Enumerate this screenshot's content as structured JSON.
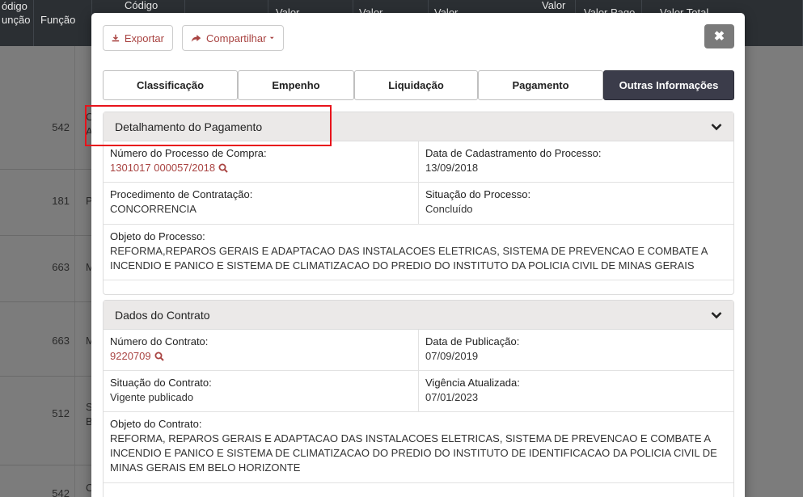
{
  "background_table": {
    "headers": [
      {
        "line1": "ódigo",
        "line2": "unção"
      },
      {
        "line1": "Função",
        "line2": ""
      },
      {
        "line1": "Código",
        "line2": ""
      },
      {
        "line1": "Valor",
        "line2": ""
      },
      {
        "line1": "Valor",
        "line2": ""
      },
      {
        "line1": "Valor Pago",
        "line2": ""
      },
      {
        "line1": "Valor",
        "line2": ""
      },
      {
        "line1": "Valor Pago",
        "line2": ""
      },
      {
        "line1": "Valor Total",
        "line2": ""
      }
    ],
    "rows": [
      {
        "num": "542",
        "letter": "C",
        "letter2": "A"
      },
      {
        "num": "181",
        "letter": "P",
        "letter2": ""
      },
      {
        "num": "663",
        "letter": "M",
        "letter2": ""
      },
      {
        "num": "663",
        "letter": "M",
        "letter2": ""
      },
      {
        "num": "512",
        "letter": "S",
        "letter2": "B"
      },
      {
        "num": "542",
        "letter": "C",
        "letter2": ""
      }
    ]
  },
  "toolbar": {
    "export_label": "Exportar",
    "share_label": "Compartilhar",
    "close_label": "✖"
  },
  "tabs": [
    {
      "label": "Classificação",
      "active": false
    },
    {
      "label": "Empenho",
      "active": false
    },
    {
      "label": "Liquidação",
      "active": false
    },
    {
      "label": "Pagamento",
      "active": false
    },
    {
      "label": "Outras Informações",
      "active": true
    }
  ],
  "payment_detail": {
    "title": "Detalhamento do Pagamento",
    "process_number_label": "Número do Processo de Compra:",
    "process_number_value": "1301017 000057/2018",
    "registration_date_label": "Data de Cadastramento do Processo:",
    "registration_date_value": "13/09/2018",
    "procedure_label": "Procedimento de Contratação:",
    "procedure_value": "CONCORRENCIA",
    "process_status_label": "Situação do Processo:",
    "process_status_value": "Concluído",
    "object_label": "Objeto do Processo:",
    "object_line1": "REFORMA,REPAROS GERAIS E ADAPTACAO DAS INSTALACOES ELETRICAS, SISTEMA DE PREVENCAO E COMBATE A",
    "object_line2": "INCENDIO E PANICO E SISTEMA DE CLIMATIZACAO DO PREDIO DO INSTITUTO DA POLICIA CIVIL DE MINAS GERAIS"
  },
  "contract": {
    "title": "Dados do Contrato",
    "number_label": "Número do Contrato:",
    "number_value": "9220709",
    "publication_label": "Data de Publicação:",
    "publication_value": "07/09/2019",
    "status_label": "Situação do Contrato:",
    "status_value": "Vigente publicado",
    "validity_label": "Vigência Atualizada:",
    "validity_value": "07/01/2023",
    "object_label": "Objeto do Contrato:",
    "object_line1": "REFORMA, REPAROS GERAIS E ADAPTACAO DAS INSTALACOES ELETRICAS, SISTEMA DE PREVENCAO E COMBATE A",
    "object_line2": "INCENDIO E PANICO E SISTEMA DE CLIMATIZACAO DO PREDIO DO INSTITUTO DE IDENTIFICACAO DA POLICIA CIVIL DE",
    "object_line3": "MINAS GERAIS EM BELO HORIZONTE"
  },
  "colors": {
    "accent": "#a94442",
    "active_tab": "#3b3c4a",
    "highlight_box": "#e8131b"
  }
}
